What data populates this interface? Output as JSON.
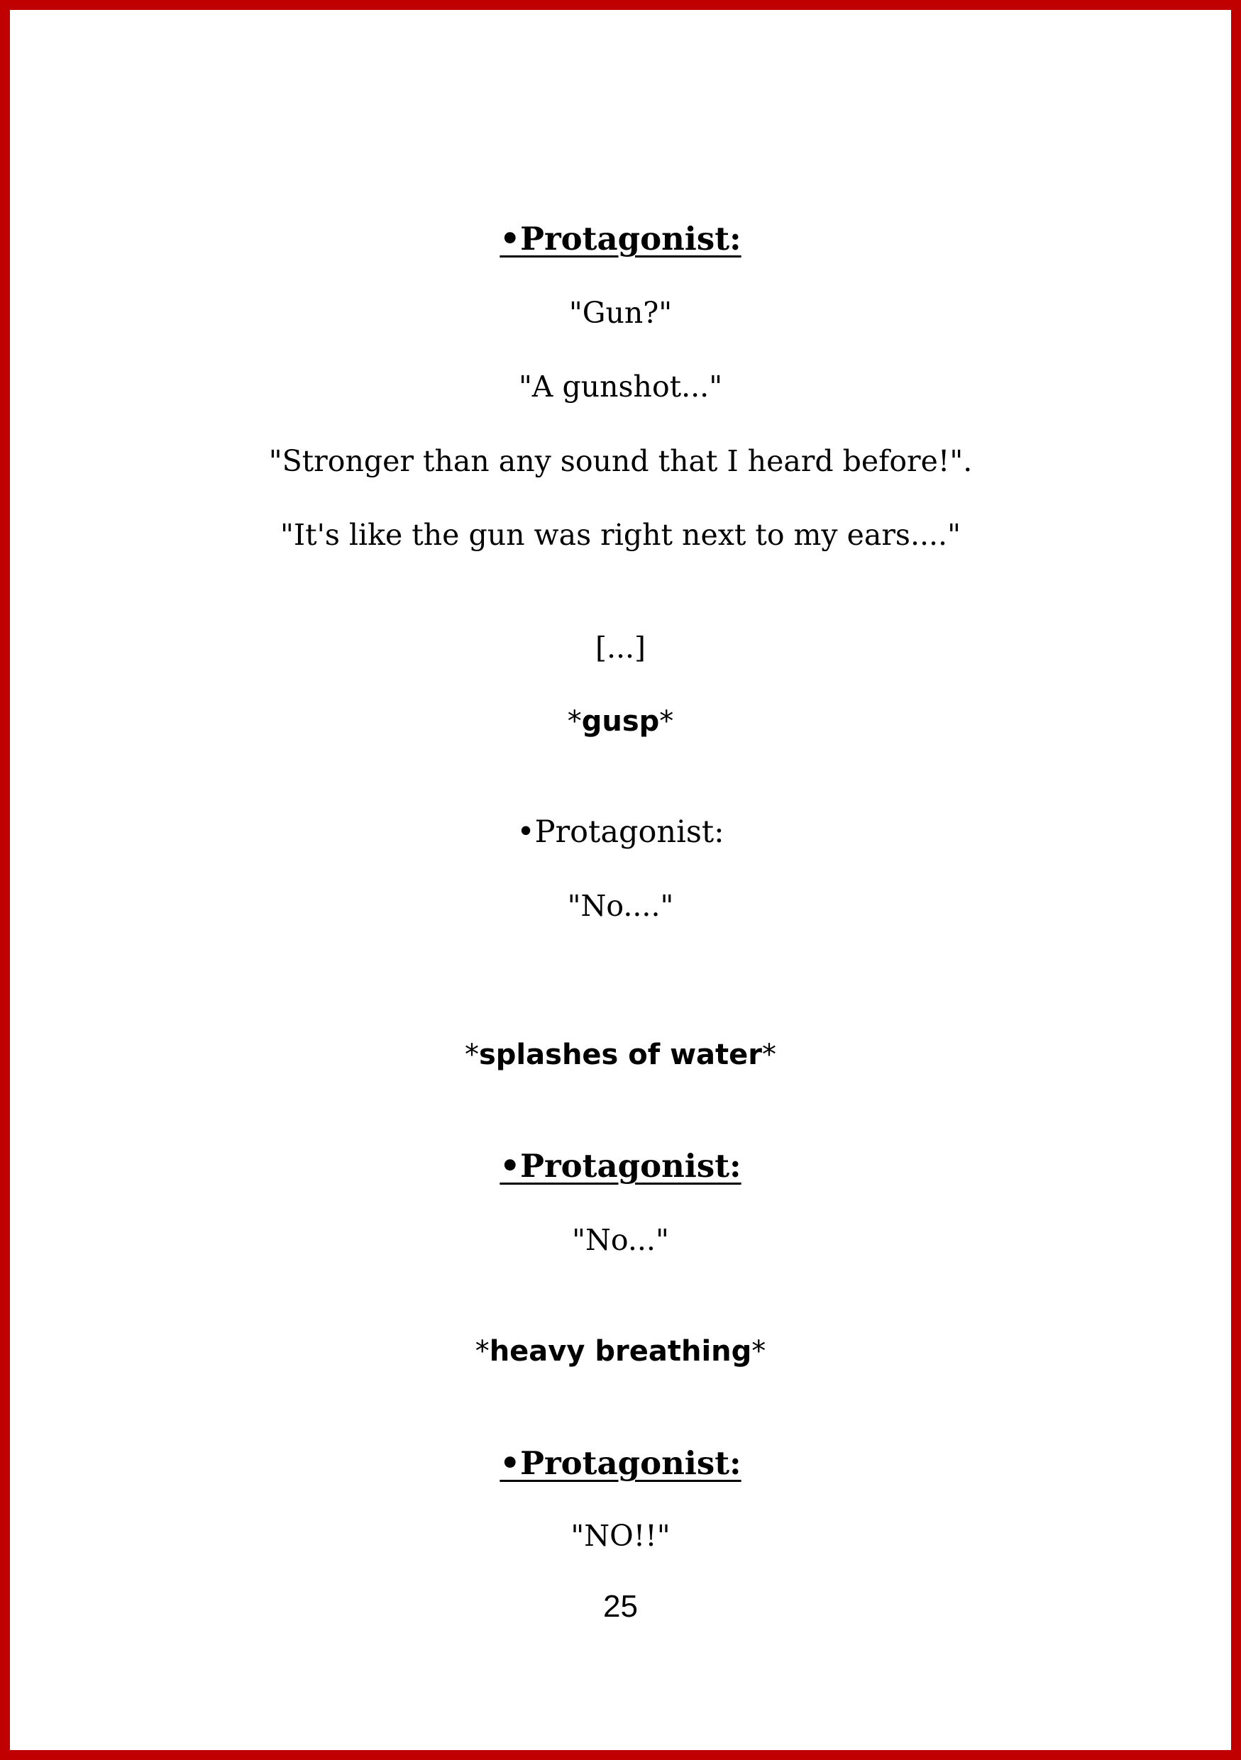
{
  "page": {
    "border_color": "#c00000",
    "background": "#ffffff",
    "page_number": "25"
  },
  "lines": {
    "speaker_1": "•Protagonist:",
    "dialog_1": "\"Gun?\"",
    "dialog_2": "\"A gunshot...\"",
    "dialog_3": "\"Stronger than any sound that I heard before!\".",
    "dialog_4": "\"It's like the gun was right next to my ears....\"",
    "ellipsis": "[...]",
    "sfx_1": {
      "open": "*",
      "word": "gusp",
      "close": "*"
    },
    "speaker_2": "•Protagonist:",
    "dialog_5": "\"No....\"",
    "sfx_2": {
      "open": "*",
      "word": "splashes of water",
      "close": "*"
    },
    "speaker_3": "•Protagonist:",
    "dialog_6": "\"No...\"",
    "sfx_3": {
      "open": "*",
      "word": "heavy breathing",
      "close": "*"
    },
    "speaker_4": "•Protagonist:",
    "dialog_7": "\"NO!!\""
  }
}
